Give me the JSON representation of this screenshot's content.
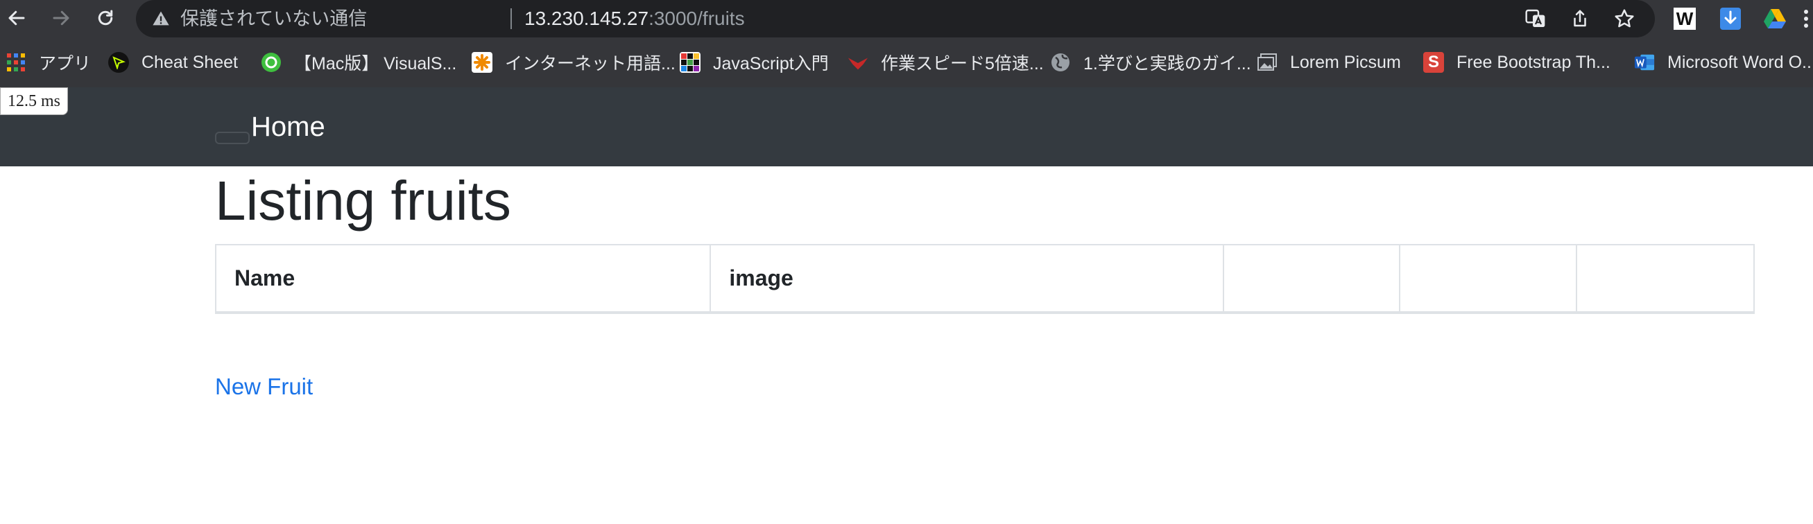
{
  "browser": {
    "security_status": "保護されていない通信",
    "url_host": "13.230.145.27",
    "url_rest": ":3000/fruits",
    "bookmarks": [
      {
        "label": "アプリ",
        "icon": "apps-grid-icon"
      },
      {
        "label": "Cheat Sheet",
        "icon": "cheat-sheet-icon"
      },
      {
        "label": "【Mac版】 VisualS...",
        "icon": "circle-logo-icon"
      },
      {
        "label": "インターネット用語...",
        "icon": "orange-asterisk-icon"
      },
      {
        "label": "JavaScript入門",
        "icon": "pixel-grid-icon"
      },
      {
        "label": "作業スピード5倍速...",
        "icon": "red-bird-icon"
      },
      {
        "label": "1.学びと実践のガイ...",
        "icon": "globe-icon"
      },
      {
        "label": "Lorem Picsum",
        "icon": "picture-icon"
      },
      {
        "label": "Free Bootstrap Th...",
        "icon": "s-logo-icon"
      },
      {
        "label": "Microsoft Word O...",
        "icon": "word-icon"
      }
    ]
  },
  "perf": {
    "timer": "12.5 ms"
  },
  "navbar": {
    "brand": "Home"
  },
  "page": {
    "title": "Listing fruits",
    "table": {
      "headers": [
        "Name",
        "image",
        "",
        "",
        ""
      ]
    },
    "new_link": "New Fruit"
  },
  "colors": {
    "toolbar_bg": "#35363a",
    "omnibox_bg": "#202124",
    "navbar_bg": "#343a40",
    "link": "#1a73e8",
    "text": "#212529"
  }
}
